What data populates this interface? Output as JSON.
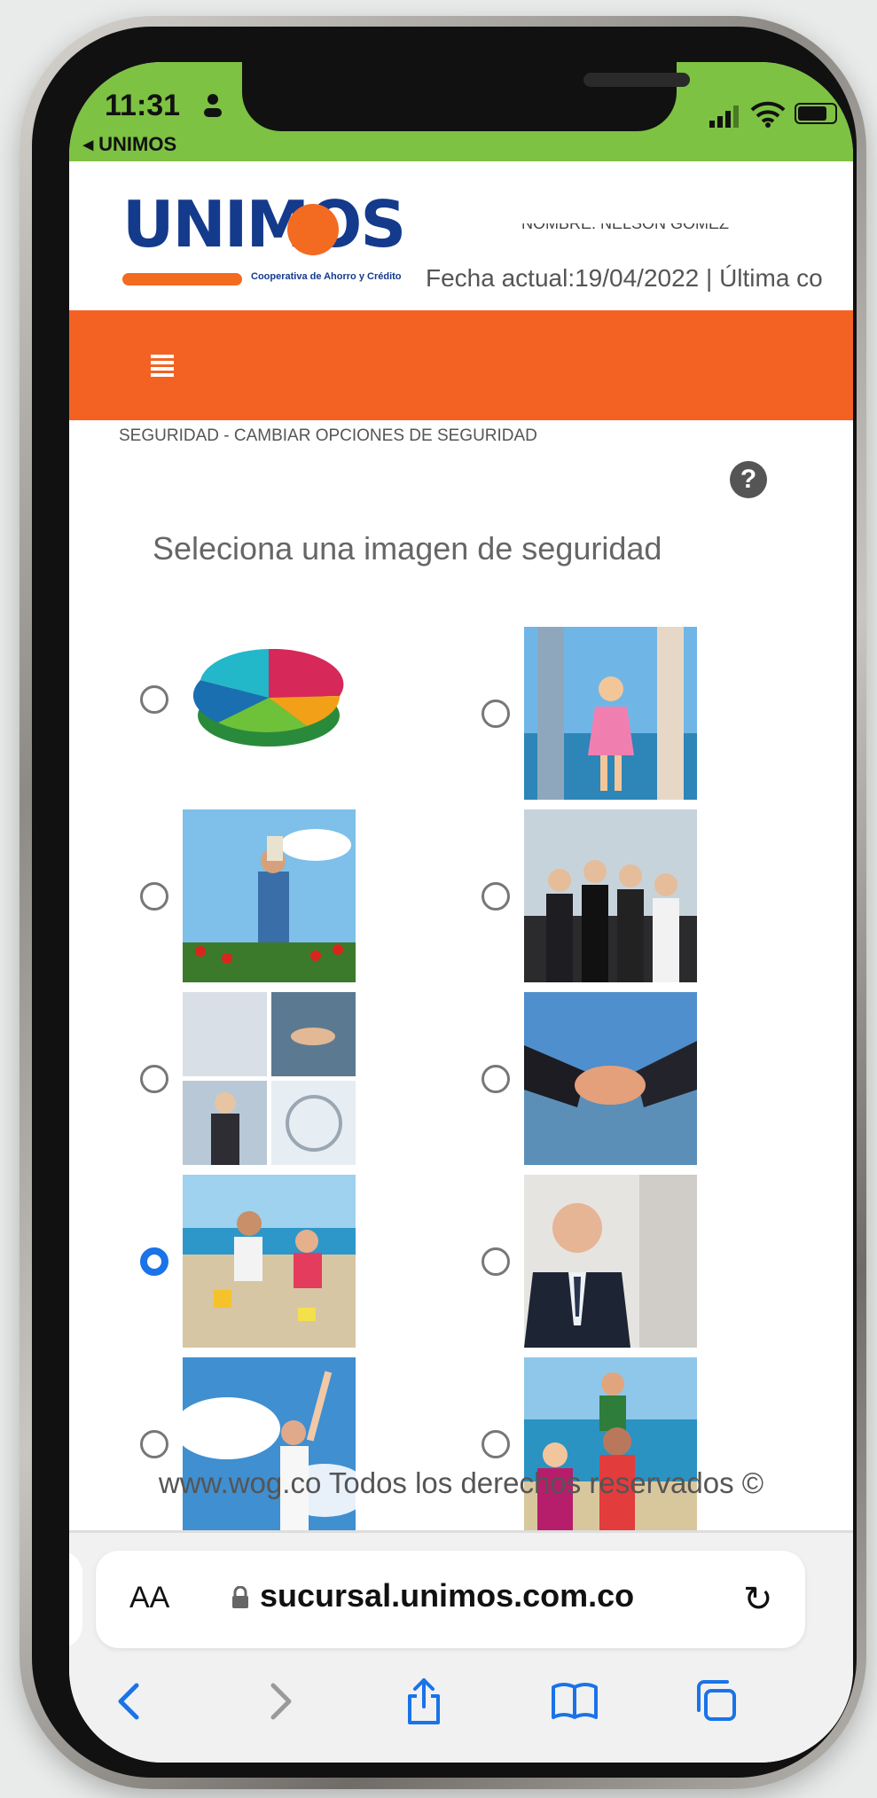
{
  "status_bar": {
    "time": "11:31",
    "back_app": "◂ UNIMOS"
  },
  "header": {
    "logo_text": "UNIMOS",
    "logo_subtitle": "Cooperativa de Ahorro y Crédito",
    "user_line": "NOMBRE: NELSON GOMEZ",
    "date_line": "Fecha actual:19/04/2022 | Última co"
  },
  "page": {
    "breadcrumb": "SEGURIDAD - CAMBIAR OPCIONES DE SEGURIDAD",
    "help_icon": "?",
    "prompt": "Seleciona una imagen de seguridad",
    "selected_index": 6,
    "images": [
      {
        "name": "pie-chart-3d"
      },
      {
        "name": "child-swinging-beach"
      },
      {
        "name": "father-child-flower-field"
      },
      {
        "name": "business-team-celebrating"
      },
      {
        "name": "office-collage-handshake"
      },
      {
        "name": "handshake-glass-building"
      },
      {
        "name": "family-sand-beach"
      },
      {
        "name": "businessman-smiling"
      },
      {
        "name": "man-raising-arm-sky"
      },
      {
        "name": "family-at-seaside"
      }
    ]
  },
  "footer": {
    "text": "www.wog.co Todos los derechos reservados ©"
  },
  "browser": {
    "aa_label": "AA",
    "url": "sucursal.unimos.com.co",
    "icons": [
      "back-icon",
      "forward-icon",
      "share-icon",
      "bookmarks-icon",
      "tabs-icon"
    ]
  },
  "colors": {
    "status_green": "#7dc242",
    "brand_orange": "#f36223",
    "brand_blue": "#143a8c",
    "radio_selected": "#1a73e8"
  }
}
